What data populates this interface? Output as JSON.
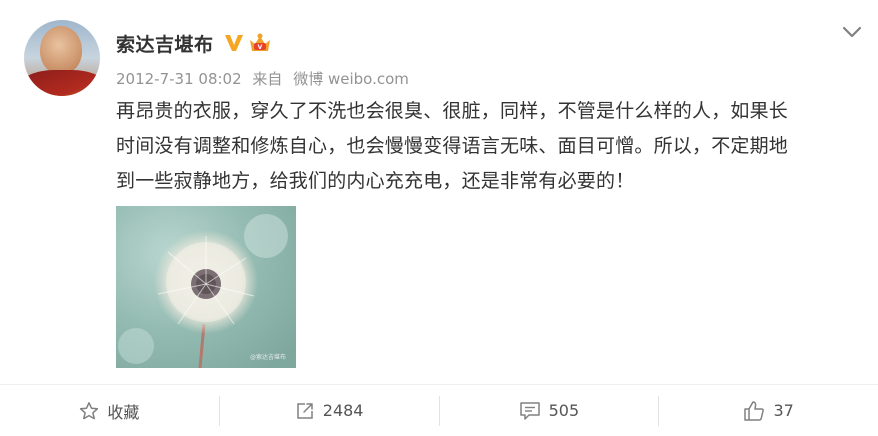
{
  "post": {
    "author": "索达吉堪布",
    "timestamp": "2012-7-31 08:02",
    "via_label": "来自",
    "source": "微博 weibo.com",
    "text_lines": [
      "再昂贵的衣服，穿久了不洗也会很臭、很脏，同样，不管是什么样的人，如果长",
      "时间没有调整和修炼自心，也会慢慢变得语言无味、面目可憎。所以，不定期地",
      "到一些寂静地方，给我们的内心充充电，还是非常有必要的！"
    ],
    "image_watermark": "@索达吉堪布"
  },
  "actions": {
    "favorite": {
      "label": "收藏",
      "icon": "star-icon"
    },
    "repost": {
      "count": "2484",
      "icon": "share-icon"
    },
    "comment": {
      "count": "505",
      "icon": "comment-icon"
    },
    "like": {
      "count": "37",
      "icon": "thumbs-up-icon"
    }
  },
  "colors": {
    "verified": "#f5a623",
    "meta": "#939393",
    "text": "#333333"
  }
}
